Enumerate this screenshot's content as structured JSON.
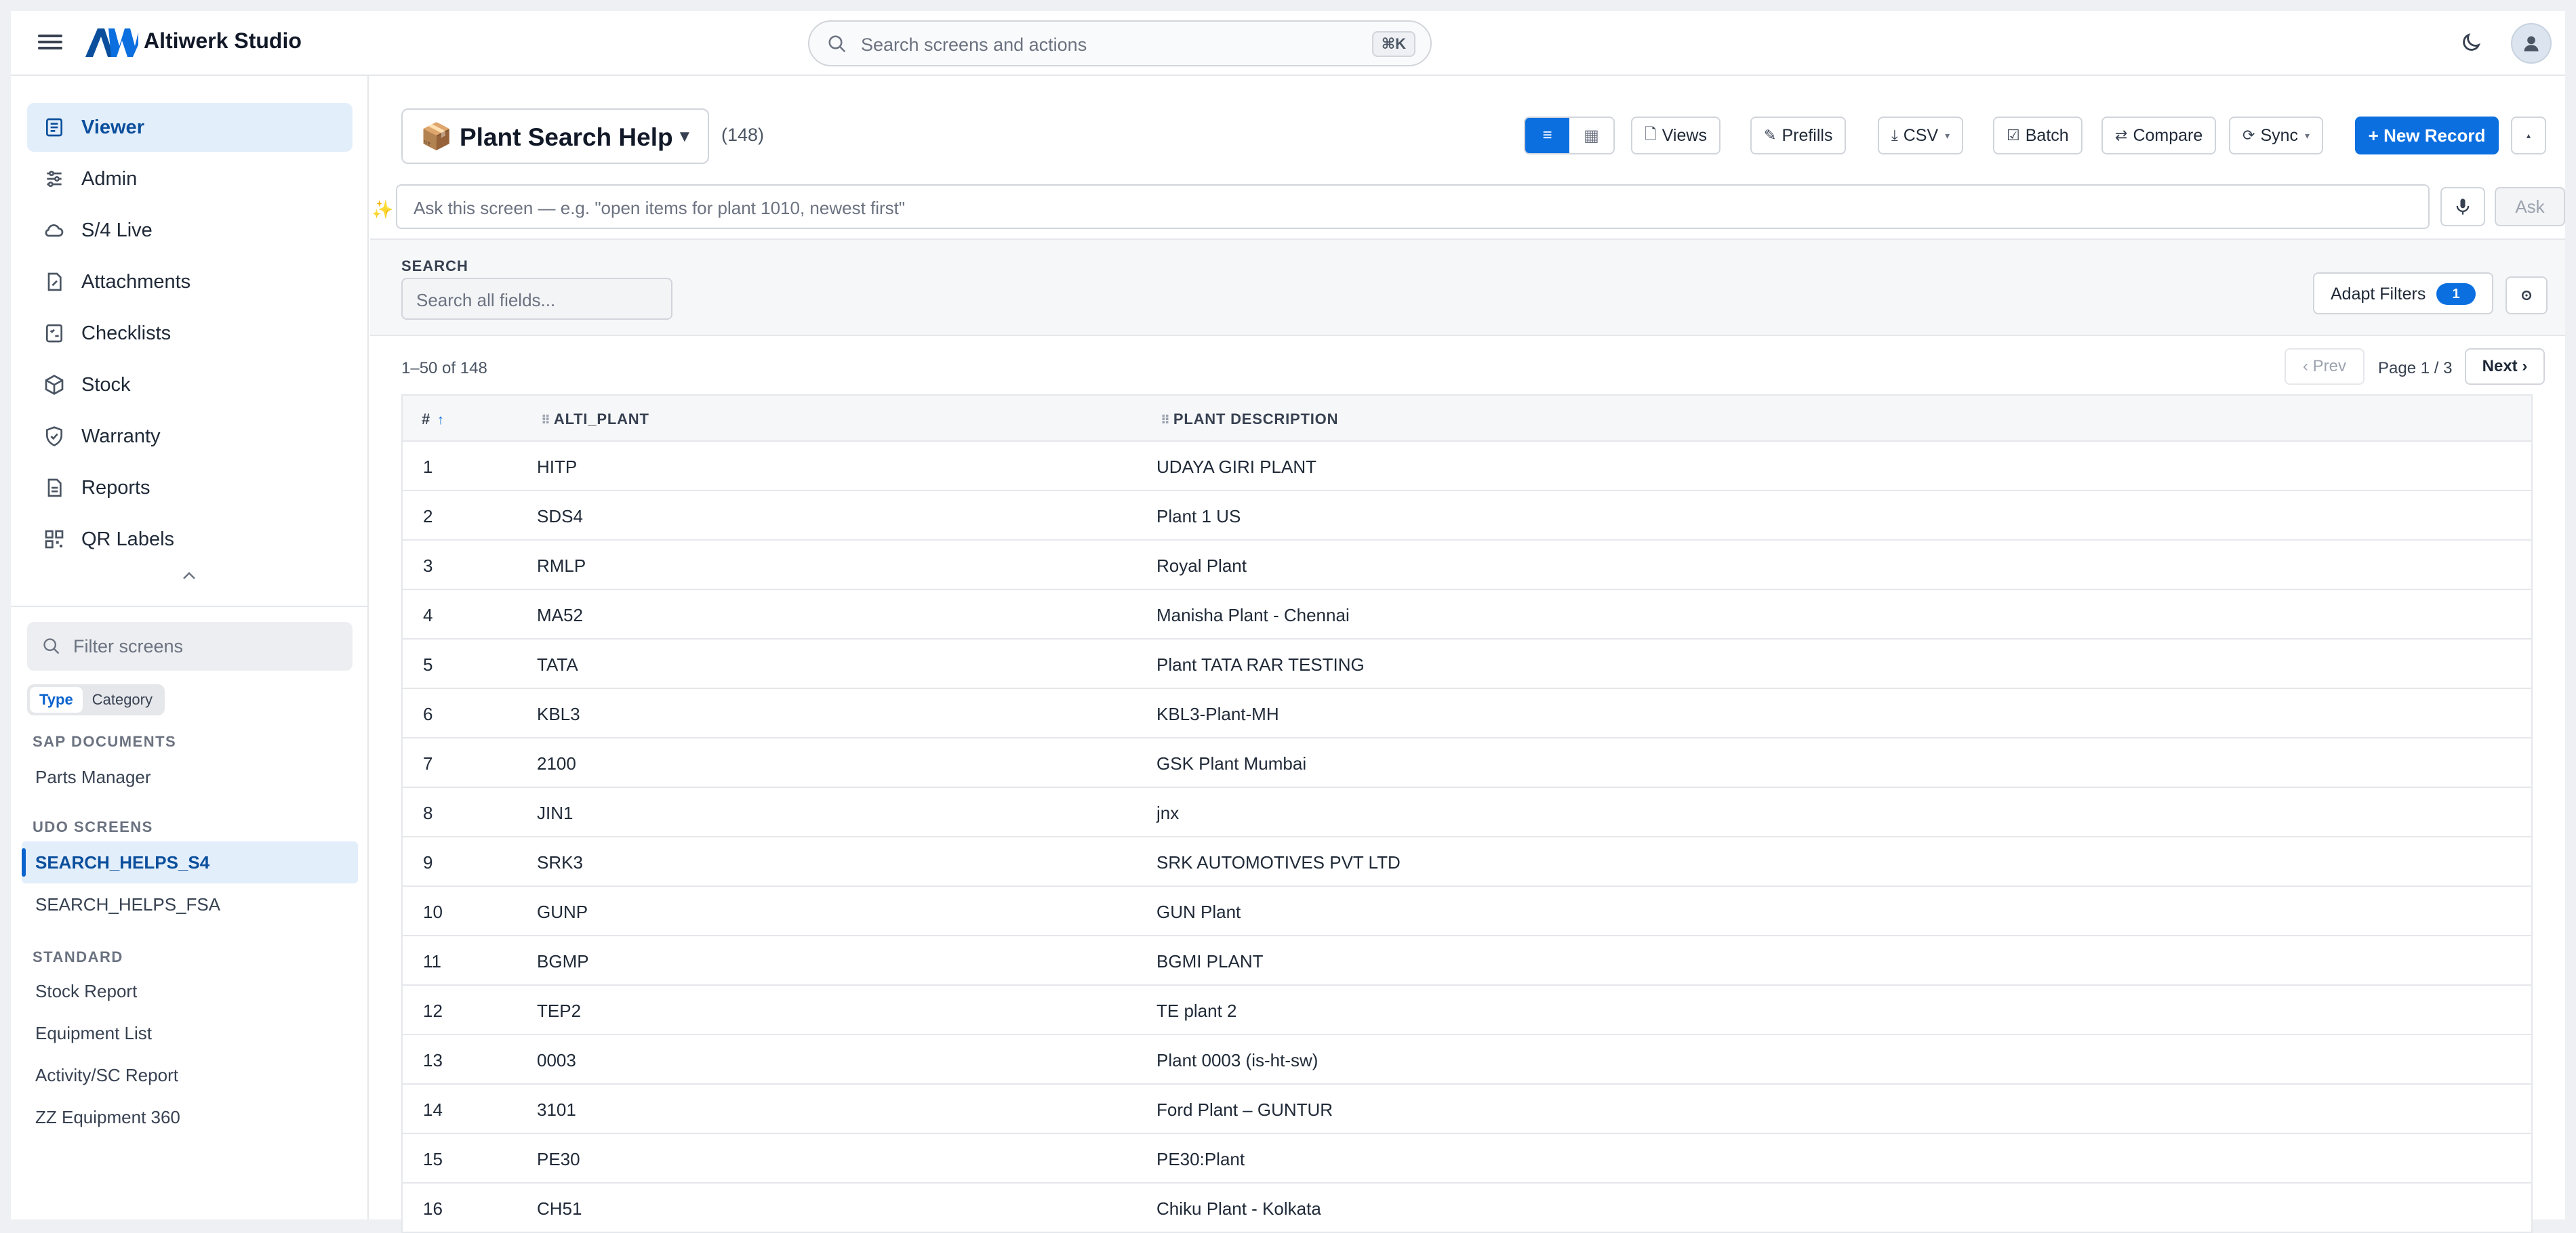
{
  "app": {
    "title": "Altiwerk Studio",
    "search_placeholder": "Search screens and actions",
    "search_shortcut": "⌘K",
    "accent_color": "#0b6fe0"
  },
  "sidebar": {
    "nav": [
      {
        "label": "Viewer",
        "icon": "document-icon",
        "active": true
      },
      {
        "label": "Admin",
        "icon": "sliders-icon"
      },
      {
        "label": "S/4 Live",
        "icon": "cloud-icon"
      },
      {
        "label": "Attachments",
        "icon": "attachment-icon"
      },
      {
        "label": "Checklists",
        "icon": "checklist-icon"
      },
      {
        "label": "Stock",
        "icon": "box-icon"
      },
      {
        "label": "Warranty",
        "icon": "shield-check-icon"
      },
      {
        "label": "Reports",
        "icon": "report-icon"
      },
      {
        "label": "QR Labels",
        "icon": "qr-icon"
      }
    ],
    "filter_placeholder": "Filter screens",
    "toggle": {
      "type": "Type",
      "category": "Category"
    },
    "sections": {
      "sap": {
        "title": "SAP DOCUMENTS",
        "items": [
          "Parts Manager"
        ]
      },
      "udo": {
        "title": "UDO SCREENS",
        "items": [
          "SEARCH_HELPS_S4",
          "SEARCH_HELPS_FSA"
        ]
      },
      "standard": {
        "title": "STANDARD",
        "items": [
          "Stock Report",
          "Equipment List",
          "Activity/SC Report",
          "ZZ Equipment 360"
        ]
      }
    }
  },
  "main": {
    "screen_emoji": "📦",
    "screen_title": "Plant Search Help",
    "record_count": "(148)",
    "toolbar": {
      "views": "Views",
      "prefills": "Prefills",
      "csv": "CSV",
      "batch": "Batch",
      "compare": "Compare",
      "sync": "Sync",
      "new_record": "+ New Record"
    },
    "ask_placeholder": "Ask this screen — e.g. \"open items for plant 1010, newest first\"",
    "ask_button": "Ask",
    "search_label": "SEARCH",
    "search_placeholder": "Search all fields...",
    "adapt_filters": "Adapt Filters",
    "adapt_filters_count": "1",
    "range_text": "1–50 of 148",
    "prev_label": "‹ Prev",
    "next_label": "Next ›",
    "page_text": "Page 1 / 3",
    "table": {
      "columns": [
        "#",
        "ALTI_PLANT",
        "PLANT DESCRIPTION"
      ],
      "rows": [
        [
          "1",
          "HITP",
          "UDAYA GIRI PLANT"
        ],
        [
          "2",
          "SDS4",
          "Plant 1 US"
        ],
        [
          "3",
          "RMLP",
          "Royal Plant"
        ],
        [
          "4",
          "MA52",
          "Manisha Plant - Chennai"
        ],
        [
          "5",
          "TATA",
          "Plant TATA RAR TESTING"
        ],
        [
          "6",
          "KBL3",
          "KBL3-Plant-MH"
        ],
        [
          "7",
          "2100",
          "GSK Plant Mumbai"
        ],
        [
          "8",
          "JIN1",
          "jnx"
        ],
        [
          "9",
          "SRK3",
          "SRK AUTOMOTIVES PVT LTD"
        ],
        [
          "10",
          "GUNP",
          "GUN Plant"
        ],
        [
          "11",
          "BGMP",
          "BGMI PLANT"
        ],
        [
          "12",
          "TEP2",
          "TE plant 2"
        ],
        [
          "13",
          "0003",
          "Plant 0003 (is-ht-sw)"
        ],
        [
          "14",
          "3101",
          "Ford Plant – GUNTUR"
        ],
        [
          "15",
          "PE30",
          "PE30:Plant"
        ],
        [
          "16",
          "CH51",
          "Chiku Plant - Kolkata"
        ]
      ]
    }
  }
}
